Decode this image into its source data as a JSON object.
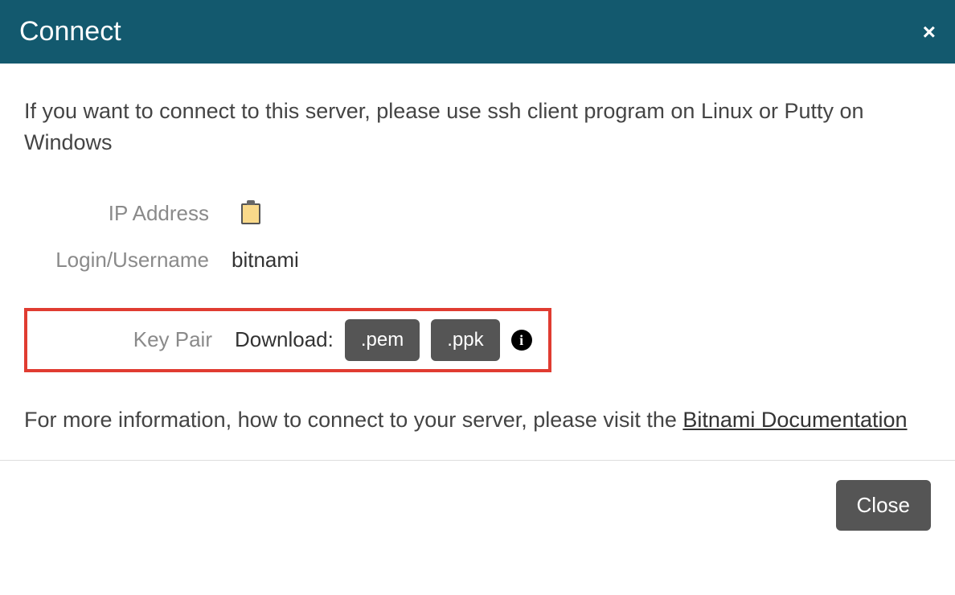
{
  "header": {
    "title": "Connect",
    "close_icon_label": "×"
  },
  "body": {
    "intro": "If you want to connect to this server, please use ssh client program on Linux or Putty on Windows",
    "rows": {
      "ip_label": "IP Address",
      "ip_value": "",
      "login_label": "Login/Username",
      "login_value": "bitnami",
      "keypair_label": "Key Pair",
      "download_label": "Download:",
      "pem_btn": ".pem",
      "ppk_btn": ".ppk"
    },
    "footer_text_pre": "For more information, how to connect to your server, please visit the ",
    "link_text": "Bitnami Documentation"
  },
  "footer": {
    "close_btn": "Close"
  }
}
